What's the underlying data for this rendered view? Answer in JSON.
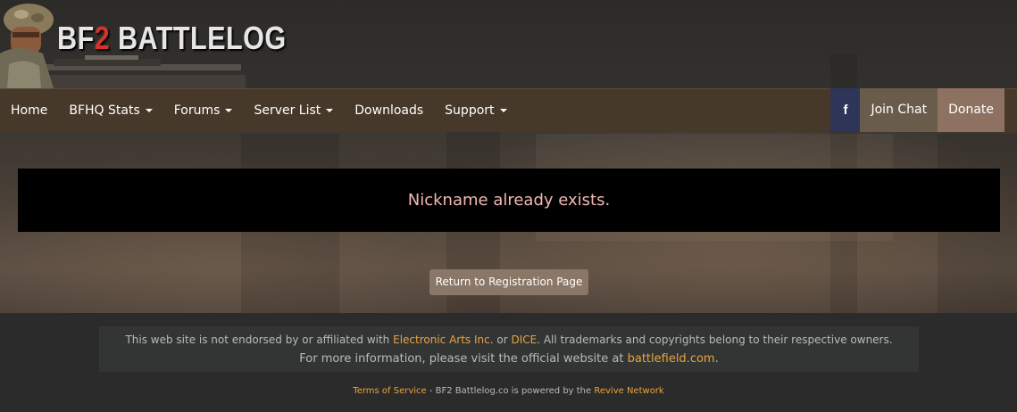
{
  "logo": {
    "prefix": "BF",
    "number": "2",
    "suffix": " BATTLELOG",
    "icon": "soldier-emblem-icon"
  },
  "nav": {
    "items": [
      {
        "label": "Home",
        "dropdown": false
      },
      {
        "label": "BFHQ Stats",
        "dropdown": true
      },
      {
        "label": "Forums",
        "dropdown": true
      },
      {
        "label": "Server List",
        "dropdown": true
      },
      {
        "label": "Downloads",
        "dropdown": false
      },
      {
        "label": "Support",
        "dropdown": true
      }
    ],
    "facebook_icon_glyph": "f",
    "join_chat": "Join Chat",
    "donate": "Donate"
  },
  "alert": {
    "message": "Nickname already exists."
  },
  "return_button": {
    "label": "Return to Registration Page"
  },
  "footer": {
    "disclaimer_pre": "This web site is not endorsed by or affiliated with ",
    "ea_link": "Electronic Arts Inc.",
    "disclaimer_mid": " or ",
    "dice_link": "DICE",
    "disclaimer_post": ". All trademarks and copyrights belong to their respective owners.",
    "info_pre": "For more information, please visit the official website at ",
    "battlefield_link": "battlefield.com",
    "info_post": ".",
    "terms_link": "Terms of Service",
    "powered_text": " - BF2 Battlelog.co is powered by the ",
    "revive_link": "Revive Network"
  },
  "colors": {
    "navbar": "#47392a",
    "facebook": "#2f3559",
    "join_chat": "#6a5c4b",
    "donate": "#8e7161",
    "alert_text": "#f2b8b3",
    "link_orange": "#e8a33c",
    "return_button": "#8a7767"
  }
}
